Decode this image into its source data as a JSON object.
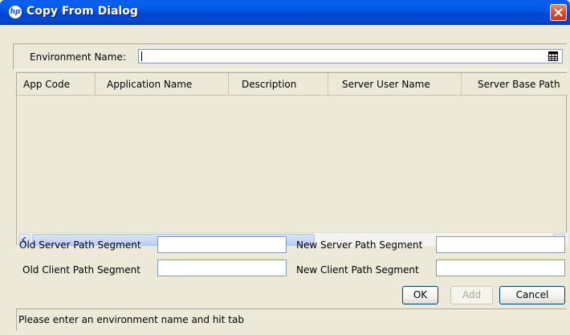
{
  "window": {
    "title": "Copy From Dialog",
    "logo_text": "hp"
  },
  "environment": {
    "label": "Environment Name:",
    "value": ""
  },
  "table": {
    "columns": [
      "App Code",
      "Application Name",
      "Description",
      "Server User Name",
      "Server Base Path"
    ],
    "rows": []
  },
  "path_fields": {
    "old_server_label": "Old Server Path Segment",
    "new_server_label": "New Server Path Segment",
    "old_client_label": "Old Client Path Segment",
    "new_client_label": "New Client Path Segment",
    "old_server_value": "",
    "new_server_value": "",
    "old_client_value": "",
    "new_client_value": ""
  },
  "buttons": {
    "ok": "OK",
    "add": "Add",
    "cancel": "Cancel"
  },
  "status_text": "Please enter an environment name and hit tab"
}
